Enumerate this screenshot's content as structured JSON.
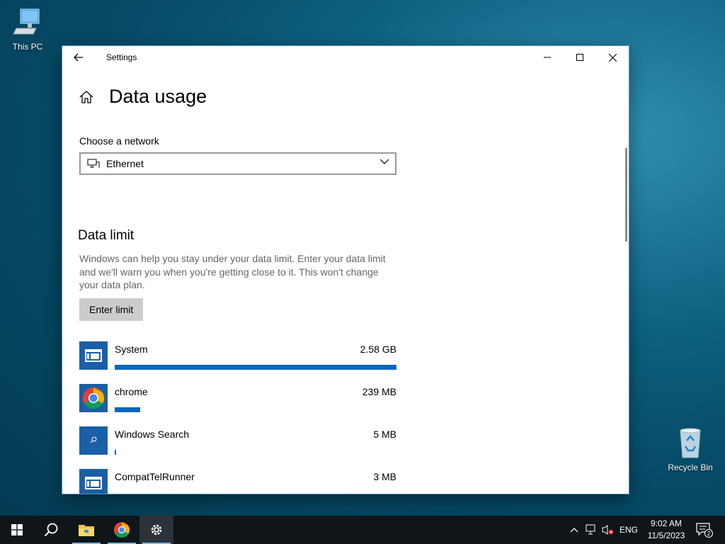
{
  "desktop": {
    "this_pc_label": "This PC",
    "recycle_bin_label": "Recycle Bin"
  },
  "window": {
    "title": "Settings",
    "page_title": "Data usage"
  },
  "network": {
    "label": "Choose a network",
    "selected": "Ethernet"
  },
  "data_limit": {
    "title": "Data limit",
    "description": "Windows can help you stay under your data limit. Enter your data limit and we'll warn you when you're getting close to it. This won't change your data plan.",
    "button": "Enter limit"
  },
  "apps": [
    {
      "name": "System",
      "size": "2.58 GB",
      "usage_fraction": 1.0
    },
    {
      "name": "chrome",
      "size": "239 MB",
      "usage_fraction": 0.09
    },
    {
      "name": "Windows Search",
      "size": "5 MB",
      "usage_fraction": 0.004
    },
    {
      "name": "CompatTelRunner",
      "size": "3 MB",
      "usage_fraction": 0.0
    }
  ],
  "taskbar": {
    "language": "ENG",
    "time": "9:02 AM",
    "date": "11/5/2023",
    "notification_count": "2"
  },
  "colors": {
    "accent": "#0067c0",
    "app_tile": "#1a5fa8",
    "taskbar": "#0f1518"
  }
}
